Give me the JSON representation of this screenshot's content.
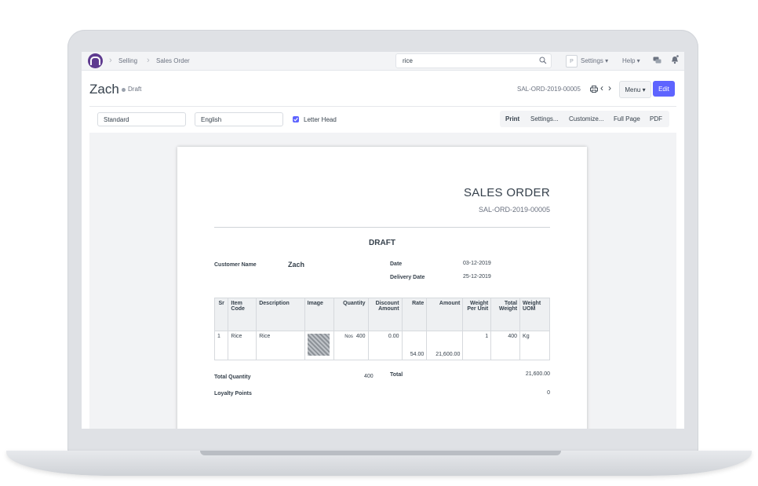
{
  "navbar": {
    "breadcrumbs": [
      "Selling",
      "Sales Order"
    ],
    "search_value": "rice",
    "avatar_initial": "P",
    "settings_label": "Settings",
    "help_label": "Help"
  },
  "header": {
    "title": "Zach",
    "status": "Draft",
    "doc_name": "SAL-ORD-2019-00005",
    "menu_label": "Menu",
    "edit_label": "Edit"
  },
  "print_toolbar": {
    "print_format": "Standard",
    "language": "English",
    "letter_head_label": "Letter Head",
    "letter_head_checked": true,
    "buttons": [
      "Print",
      "Settings...",
      "Customize...",
      "Full Page",
      "PDF"
    ]
  },
  "document": {
    "heading": "SALES ORDER",
    "number": "SAL-ORD-2019-00005",
    "watermark": "DRAFT",
    "customer_name_label": "Customer Name",
    "customer_name": "Zach",
    "date_label": "Date",
    "date": "03-12-2019",
    "delivery_date_label": "Delivery Date",
    "delivery_date": "25-12-2019",
    "columns": [
      "Sr",
      "Item Code",
      "Description",
      "Image",
      "Quantity",
      "Discount Amount",
      "Rate",
      "Amount",
      "Weight Per Unit",
      "Total Weight",
      "Weight UOM"
    ],
    "rows": [
      {
        "sr": "1",
        "item_code": "Rice",
        "description": "Rice",
        "uom": "Nos",
        "quantity": "400",
        "discount": "0.00",
        "rate": "54.00",
        "amount": "21,600.00",
        "weight_per_unit": "1",
        "total_weight": "400",
        "weight_uom": "Kg"
      }
    ],
    "total_quantity_label": "Total Quantity",
    "total_quantity": "400",
    "total_label": "Total",
    "total": "21,600.00",
    "loyalty_points_label": "Loyalty Points",
    "loyalty_points": "0"
  }
}
